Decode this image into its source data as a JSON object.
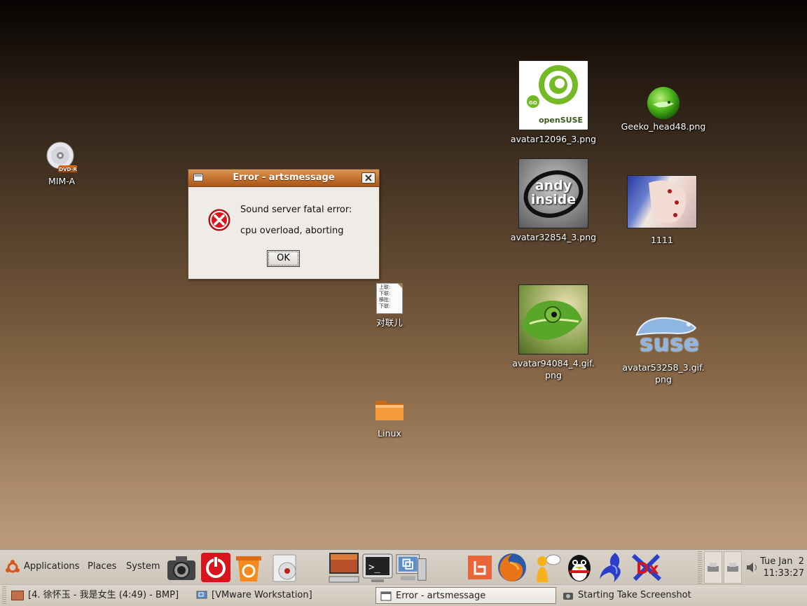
{
  "desktop": {
    "icons": [
      {
        "label": "MIM-A",
        "icon": "dvd-r-icon"
      },
      {
        "label": "avatar12096_3.png",
        "icon": "opensuse-thumb"
      },
      {
        "label": "Geeko_head48.png",
        "icon": "geeko-icon"
      },
      {
        "label": "avatar32854_3.png",
        "icon": "andy-inside-thumb"
      },
      {
        "label": "1111",
        "icon": "hand-photo-thumb"
      },
      {
        "label": "对联儿",
        "icon": "text-file-icon"
      },
      {
        "label": "avatar94084_4.gif.",
        "label2": "png",
        "icon": "chameleon-thumb"
      },
      {
        "label": "avatar53258_3.gif.",
        "label2": "png",
        "icon": "suse-logo-thumb"
      },
      {
        "label": "Linux",
        "icon": "folder-icon"
      }
    ],
    "thumb_texts": {
      "opensuse": "openSUSE",
      "go": "GO",
      "andy": "andy inside",
      "suse": "suse",
      "file_lines": [
        "上联:",
        "下联:",
        "横批:",
        "下联:"
      ]
    }
  },
  "dialog": {
    "title": "Error - artsmessage",
    "line1": "Sound server fatal error:",
    "line2": "cpu overload, aborting",
    "ok": "OK"
  },
  "top_panel": {
    "menus": [
      "Applications",
      "Places",
      "System"
    ],
    "launchers": [
      "camera-icon",
      "power-icon",
      "recycle-icon",
      "cd-player-icon",
      "monitor-icon",
      "terminal-icon",
      "vmware-icon",
      "app-b-icon",
      "firefox-icon",
      "messenger-icon",
      "qq-penguin-icon",
      "blue-bird-icon",
      "dx-icon"
    ],
    "clock": {
      "day": "Tue Jan  2",
      "time": "11:33:27"
    }
  },
  "taskbar": [
    {
      "label": "[4. 徐怀玉 - 我是女生 (4:49) - BMP]",
      "active": false
    },
    {
      "label": "[VMware Workstation]",
      "active": false
    },
    {
      "label": "Error - artsmessage",
      "active": true
    },
    {
      "label": "Starting Take Screenshot",
      "active": false
    }
  ],
  "colors": {
    "titlebar": "#c47230",
    "error_red": "#d8141c",
    "desktop_bottom": "#bd9c7c"
  }
}
